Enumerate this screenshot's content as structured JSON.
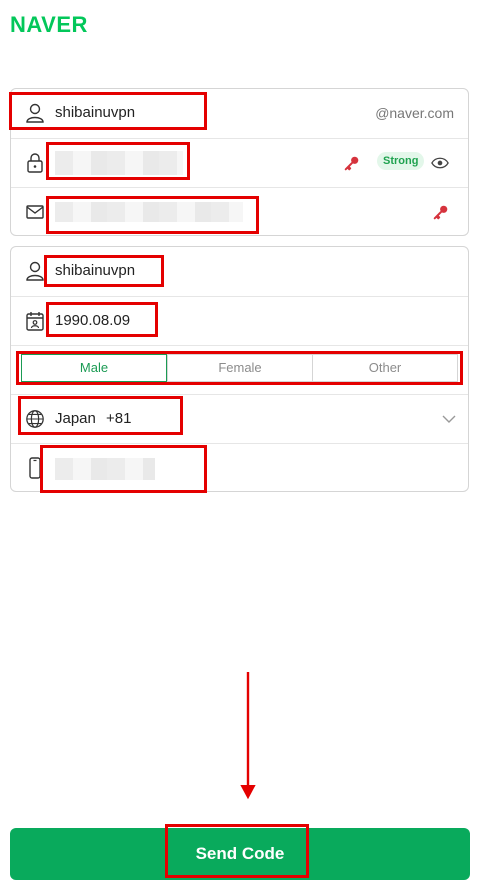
{
  "brand": {
    "logo_text": "NAVER",
    "color": "#03c75a"
  },
  "account": {
    "username": "shibainuvpn",
    "domain_suffix": "@naver.com",
    "password_strength": "Strong"
  },
  "profile": {
    "name": "shibainuvpn",
    "birthdate": "1990.08.09",
    "gender_options": [
      "Male",
      "Female",
      "Other"
    ],
    "gender_selected": "Male",
    "country": "Japan",
    "dial_code": "+81"
  },
  "actions": {
    "submit_label": "Send Code"
  },
  "colors": {
    "accent": "#09aa5c",
    "highlight": "#e40000",
    "key_icon": "#d6333d"
  }
}
